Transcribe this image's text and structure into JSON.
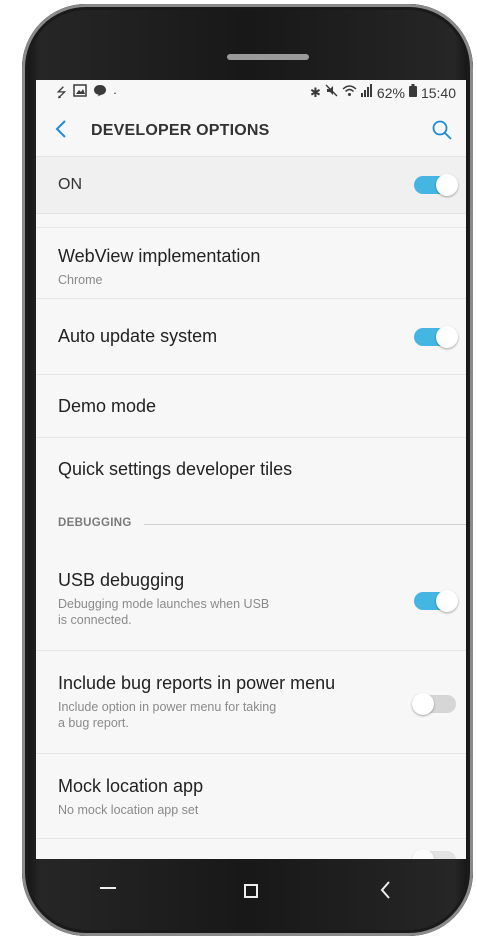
{
  "status_bar": {
    "left_icons": [
      "usb-icon",
      "image-icon",
      "message-icon",
      "dot-icon"
    ],
    "right_icons": [
      "bluetooth-icon",
      "mute-icon",
      "wifi-icon",
      "signal-icon"
    ],
    "battery": "62%",
    "time": "15:40"
  },
  "header": {
    "title": "DEVELOPER OPTIONS"
  },
  "master_toggle": {
    "label": "ON",
    "state": true
  },
  "items": [
    {
      "title": "WebView implementation",
      "subtitle": "Chrome"
    },
    {
      "title": "Auto update system",
      "toggle": true
    },
    {
      "title": "Demo mode"
    },
    {
      "title": "Quick settings developer tiles"
    }
  ],
  "section": {
    "label": "DEBUGGING"
  },
  "debug_items": [
    {
      "title": "USB debugging",
      "subtitle_line1": "Debugging mode launches when USB",
      "subtitle_line2": "is connected.",
      "toggle": true
    },
    {
      "title": "Include bug reports in power menu",
      "subtitle_line1": "Include option in power menu for taking",
      "subtitle_line2": "a bug report.",
      "toggle": false
    },
    {
      "title": "Mock location app",
      "subtitle": "No mock location app set"
    }
  ],
  "colors": {
    "accent": "#1a8cd8",
    "toggle_on": "#45b6e2",
    "toggle_off": "#d6d6d6"
  }
}
